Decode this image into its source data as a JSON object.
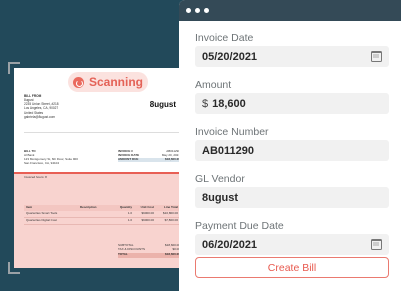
{
  "window": {
    "controls": [
      "close",
      "minimize",
      "maximize"
    ]
  },
  "form": {
    "fields": [
      {
        "label": "Invoice Date",
        "value": "05/20/2021",
        "icon": "calendar-icon"
      },
      {
        "label": "Amount",
        "prefix": "$",
        "value": "18,600"
      },
      {
        "label": "Invoice Number",
        "value": "AB011290"
      },
      {
        "label": "GL Vendor",
        "value": "8ugust"
      },
      {
        "label": "Payment Due Date",
        "value": "06/20/2021",
        "icon": "calendar-icon"
      }
    ],
    "create_button": "Create Bill"
  },
  "scanner": {
    "status": "Scanning",
    "accent": "#e85f55"
  },
  "invoice": {
    "brand": "8ugust",
    "from_label": "BILL FROM",
    "from_lines": [
      "8ugust",
      "2235 Union Street, #218",
      "Los Angeles, CA, 90027",
      "United States",
      "gabriela@8ugust.com"
    ],
    "billto_label": "BILL TO",
    "billto_lines": [
      "Al Bank",
      "123 Montgomery St, 6th Floor, Suite 900",
      "San Francisco, CA, 94104"
    ],
    "meta": [
      {
        "k": "INVOICE #",
        "v": "AB011290"
      },
      {
        "k": "INVOICE DATE",
        "v": "May 20, 2021"
      },
      {
        "k": "AMOUNT DUE",
        "v": "$18,600.00"
      }
    ],
    "notes": "Invoiced hours: 8",
    "table_headers": [
      "Item",
      "Description",
      "Quantity",
      "Unit Cost",
      "Line Total"
    ],
    "rows": [
      [
        "Quarterlies Smart Tools",
        "",
        "1.0",
        "$9000.00",
        "$10,800.00"
      ],
      [
        "Quarterlies Digital Cost",
        "",
        "1.0",
        "$9000.00",
        "$7,800.00"
      ]
    ],
    "totals": [
      {
        "k": "SUBTOTAL",
        "v": "$18,600.00"
      },
      {
        "k": "TAX & DISCOUNTS",
        "v": "$0.00"
      },
      {
        "k": "TOTAL",
        "v": "$18,600.00"
      }
    ]
  }
}
